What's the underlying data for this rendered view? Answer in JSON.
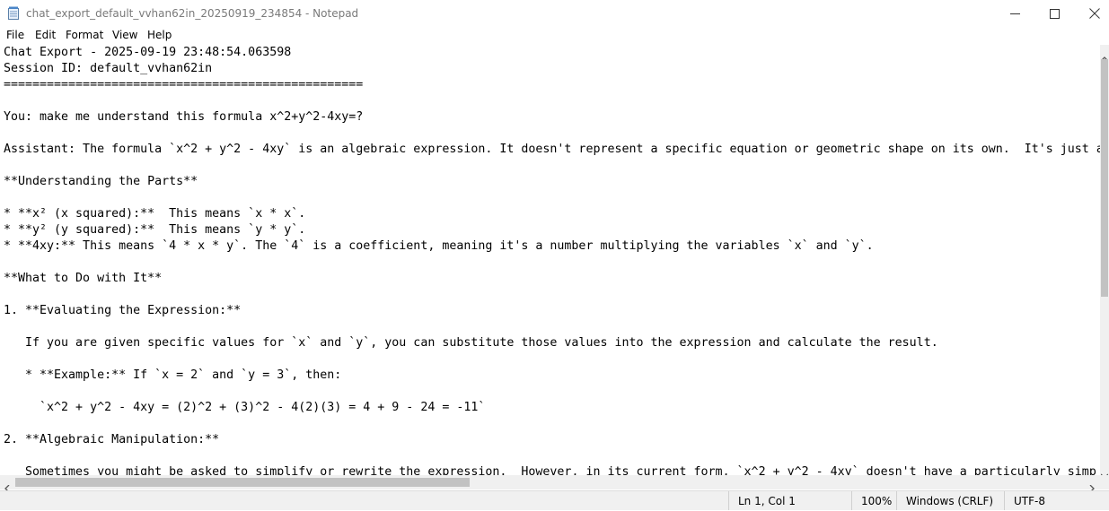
{
  "window": {
    "title": "chat_export_default_vvhan62in_20250919_234854 - Notepad",
    "controls": [
      "minimize-icon",
      "maximize-icon",
      "close-icon"
    ]
  },
  "menu": {
    "file": "File",
    "edit": "Edit",
    "format": "Format",
    "view": "View",
    "help": "Help"
  },
  "document": {
    "text": "Chat Export - 2025-09-19 23:48:54.063598\nSession ID: default_vvhan62in\n==================================================\n\nYou: make me understand this formula x^2+y^2-4xy=?\n\nAssistant: The formula `x^2 + y^2 - 4xy` is an algebraic expression. It doesn't represent a specific equation or geometric shape on its own.  It's just a\n\n**Understanding the Parts**\n\n* **x² (x squared):**  This means `x * x`.\n* **y² (y squared):**  This means `y * y`.\n* **4xy:** This means `4 * x * y`. The `4` is a coefficient, meaning it's a number multiplying the variables `x` and `y`.\n\n**What to Do with It**\n\n1. **Evaluating the Expression:**\n\n   If you are given specific values for `x` and `y`, you can substitute those values into the expression and calculate the result.\n\n   * **Example:** If `x = 2` and `y = 3`, then:\n\n     `x^2 + y^2 - 4xy = (2)^2 + (3)^2 - 4(2)(3) = 4 + 9 - 24 = -11`\n\n2. **Algebraic Manipulation:**\n\n   Sometimes you might be asked to simplify or rewrite the expression.  However, in its current form, `x^2 + y^2 - 4xy` doesn't have a particularly simp"
  },
  "status": {
    "position": "Ln 1, Col 1",
    "zoom": "100%",
    "line_ending": "Windows (CRLF)",
    "encoding": "UTF-8"
  }
}
